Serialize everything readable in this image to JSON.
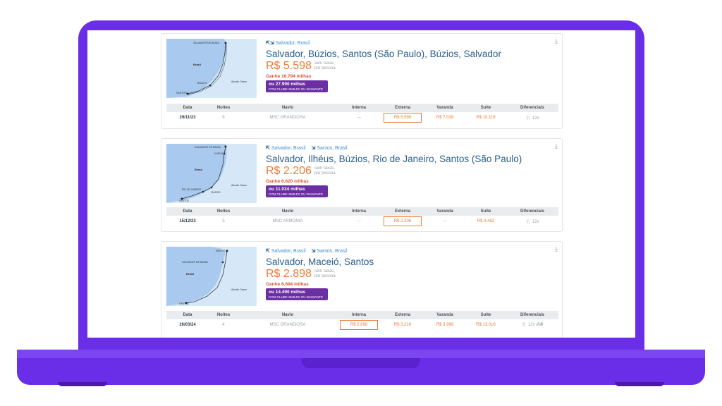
{
  "cruises": [
    {
      "ports": [
        {
          "arrow": "⇱⇲",
          "name": "Salvador, Brasil"
        }
      ],
      "title": "Salvador, Búzios, Santos (São Paulo), Búzios, Salvador",
      "price": "R$ 5.598",
      "price_note_1": "sem taxas,",
      "price_note_2": "por pessoa",
      "miles": "Ganhe 16.794 milhas",
      "club_line1": "ou 27.990 milhas",
      "club_line2": "COM CLUBE SMILES OU DIAMANTE",
      "map_labels": [
        "SALVADOR DE BAHIA",
        "Brasil",
        "BÚZIOS",
        "SANTOS",
        "Atlantic Ocean"
      ],
      "headers": [
        "Data",
        "Noites",
        "Navio",
        "Interna",
        "Externa",
        "Varanda",
        "Suite",
        "Diferenciais"
      ],
      "row": {
        "date": "29/11/23",
        "nights": "6",
        "ship": "MSC GRANDIOSA",
        "interna": "---",
        "externa": "R$ 5.598",
        "varanda": "R$ 7.038",
        "suite": "R$ 10.118",
        "diff": "🍴 12x"
      }
    },
    {
      "ports": [
        {
          "arrow": "⇱",
          "name": "Salvador, Brasil"
        },
        {
          "arrow": "⇲",
          "name": "Santos, Brasil"
        }
      ],
      "title": "Salvador, Ilhéus, Búzios, Rio de Janeiro, Santos (São Paulo)",
      "price": "R$ 2.206",
      "price_note_1": "sem taxas,",
      "price_note_2": "por pessoa",
      "miles": "Ganhe 6.620 milhas",
      "club_line1": "ou 11.034 milhas",
      "club_line2": "COM CLUBE SMILES OU DIAMANTE",
      "map_labels": [
        "SALVADOR DE BAHIA",
        "ILHÉUS",
        "Brasil",
        "RIO DE JANEIRO",
        "BÚZIOS",
        "SANTOS",
        "Atlantic Ocean"
      ],
      "headers": [
        "Data",
        "Noites",
        "Navio",
        "Interna",
        "Externa",
        "Varanda",
        "Suite",
        "Diferenciais"
      ],
      "row": {
        "date": "15/12/23",
        "nights": "5",
        "ship": "MSC ARMONIA",
        "interna": "---",
        "externa": "R$ 2.206",
        "varanda": "---",
        "suite": "R$ 4.462",
        "diff": "🍴 12x"
      }
    },
    {
      "ports": [
        {
          "arrow": "⇱",
          "name": "Salvador, Brasil"
        },
        {
          "arrow": "⇲",
          "name": "Santos, Brasil"
        }
      ],
      "title": "Salvador, Maceió, Santos",
      "price": "R$ 2.898",
      "price_note_1": "sem taxas,",
      "price_note_2": "por pessoa",
      "miles": "Ganhe 8.694 milhas",
      "club_line1": "ou 14.490 milhas",
      "club_line2": "COM CLUBE SMILES OU DIAMANTE",
      "map_labels": [
        "MACEIÓ",
        "SALVADOR DE BAHIA",
        "Brasil",
        "Atlantic Ocean",
        "SANTOS"
      ],
      "headers": [
        "Data",
        "Noites",
        "Navio",
        "Interna",
        "Externa",
        "Varanda",
        "Suite",
        "Diferenciais"
      ],
      "row": {
        "date": "26/03/24",
        "nights": "4",
        "ship": "MSC GRANDIOSA",
        "interna": "R$ 2.898",
        "externa": "R$ 3.218",
        "varanda": "R$ 3.998",
        "suite": "R$ 13.018",
        "diff": "🍴 12x 𝓢𝓑"
      }
    }
  ]
}
